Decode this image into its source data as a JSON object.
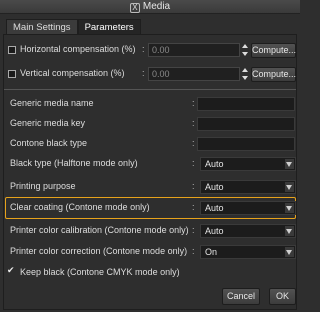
{
  "window": {
    "title": "Media",
    "close_glyph": "X"
  },
  "tabs": [
    {
      "label": "Main Settings",
      "active": false
    },
    {
      "label": "Parameters",
      "active": true
    }
  ],
  "compensation": [
    {
      "label": "Horizontal compensation (%)",
      "colon": ":",
      "value": "0.00",
      "button": "Compute...",
      "checked": false
    },
    {
      "label": "Vertical compensation (%)",
      "colon": ":",
      "value": "0.00",
      "button": "Compute...",
      "checked": false
    }
  ],
  "media_fields": [
    {
      "label": "Generic media name",
      "colon": ":",
      "value": ""
    },
    {
      "label": "Generic media key",
      "colon": ":",
      "value": ""
    },
    {
      "label": "Contone black type",
      "colon": ":",
      "value": ""
    }
  ],
  "selects": [
    {
      "label": "Black type (Halftone mode only)",
      "colon": ":",
      "value": "Auto"
    },
    {
      "label": "Printing purpose",
      "colon": ":",
      "value": "Auto"
    },
    {
      "label": "Clear coating (Contone mode only)",
      "colon": ":",
      "value": "Auto",
      "highlighted": true
    },
    {
      "label": "Printer color calibration (Contone mode only)",
      "colon": ":",
      "value": "Auto"
    },
    {
      "label": "Printer color correction (Contone mode only)",
      "colon": ":",
      "value": "On"
    }
  ],
  "keep_black": {
    "label": "Keep black (Contone CMYK mode only)",
    "checked": true
  },
  "footer": {
    "cancel_label": "Cancel",
    "ok_label": "OK"
  },
  "colors": {
    "highlight": "#e6a21b",
    "background": "#2e2e2e"
  }
}
